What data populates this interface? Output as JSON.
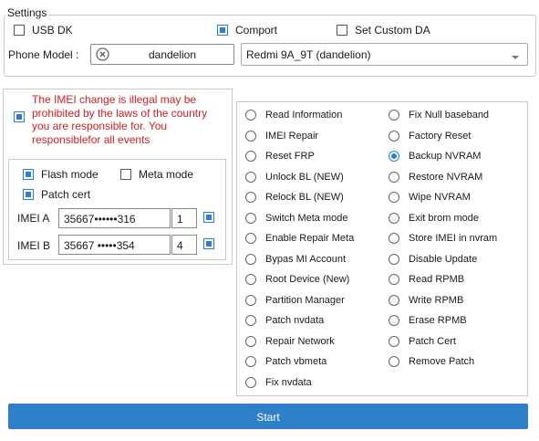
{
  "settings": {
    "title": "Settings",
    "usb_dk": {
      "label": "USB DK",
      "checked": false
    },
    "comport": {
      "label": "Comport",
      "checked": true
    },
    "set_custom_da": {
      "label": "Set Custom DA",
      "checked": false
    },
    "phone_model_label": "Phone Model :",
    "search_value": "dandelion",
    "model_select_value": "Redmi 9A_9T (dandelion)"
  },
  "warning": {
    "checked": true,
    "text_lines": [
      "The IMEI change is illegal may be",
      "prohibited by the laws of the country",
      "you are responsible for. You",
      "responsiblefor all events"
    ]
  },
  "mode": {
    "flash_mode": {
      "label": "Flash mode",
      "checked": true
    },
    "meta_mode": {
      "label": "Meta mode",
      "checked": false
    },
    "patch_cert": {
      "label": "Patch cert",
      "checked": true
    }
  },
  "imei": {
    "a": {
      "label": "IMEI A",
      "value": "35667••••••316",
      "slot": "1",
      "checked": true
    },
    "b": {
      "label": "IMEI B",
      "value": "35667 •••••354",
      "slot": "4",
      "checked": true
    }
  },
  "operations": {
    "selected": "Backup NVRAM",
    "left": [
      "Read Information",
      "IMEI Repair",
      "Reset FRP",
      "Unlock BL (NEW)",
      "Relock BL (NEW)",
      "Switch Meta mode",
      "Enable Repair Meta",
      "Bypas MI Account",
      "Root Device (New)",
      "Partition Manager",
      "Patch nvdata",
      "Repair Network",
      "Patch vbmeta",
      "Fix nvdata"
    ],
    "right": [
      "Fix Null baseband",
      "Factory Reset",
      "Backup NVRAM",
      "Restore NVRAM",
      "Wipe NVRAM",
      "Exit brom mode",
      "Store IMEI in nvram",
      "Disable Update",
      "Read RPMB",
      "Write RPMB",
      "Erase RPMB",
      "Patch Cert",
      "Remove Patch"
    ]
  },
  "start_button": {
    "label": "Start"
  },
  "colors": {
    "accent": "#2a7fd4",
    "warning_text": "#d42020",
    "button": "#2f7fc9"
  }
}
